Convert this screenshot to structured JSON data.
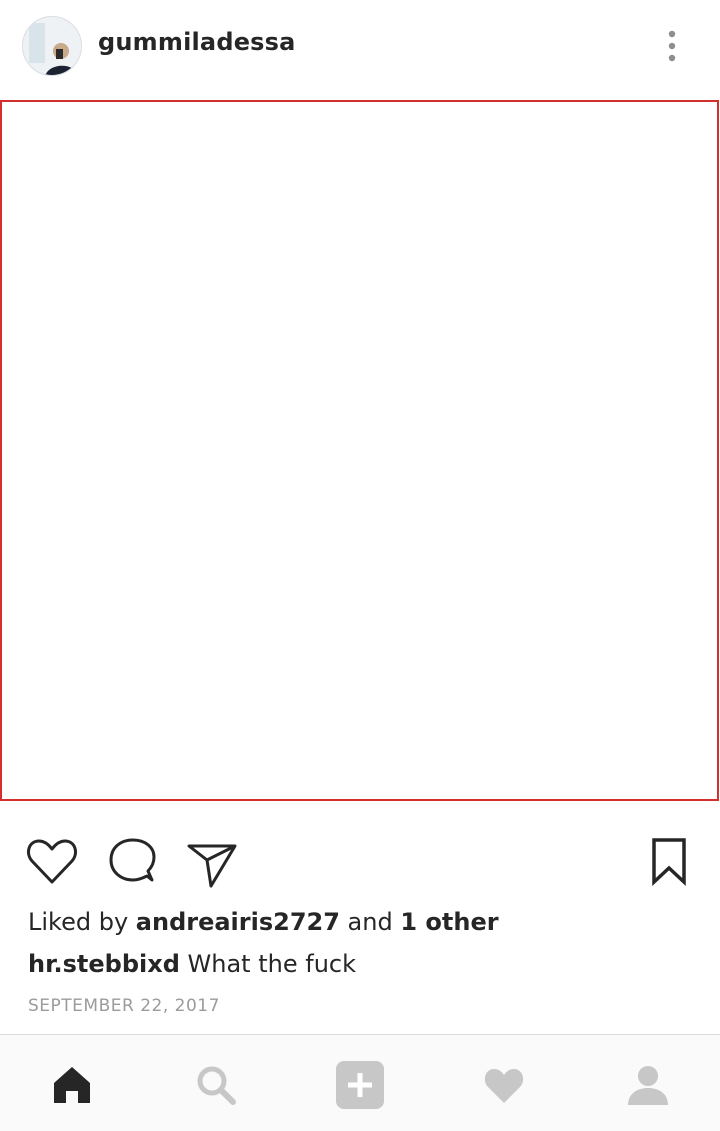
{
  "post": {
    "username": "gummiladessa",
    "likes": {
      "prefix": "Liked by ",
      "user": "andreairis2727",
      "middle": " and ",
      "others": "1 other"
    },
    "caption": {
      "user": "hr.stebbixd",
      "text": " What the fuck"
    },
    "date": "SEPTEMBER 22, 2017"
  },
  "icons": {
    "more": "more-vertical-icon",
    "like": "heart-outline-icon",
    "comment": "comment-bubble-icon",
    "share": "send-paper-plane-icon",
    "save": "bookmark-icon",
    "home": "home-icon",
    "search": "search-icon",
    "add": "add-post-icon",
    "activity": "heart-filled-icon",
    "profile": "profile-icon"
  },
  "colors": {
    "text": "#262626",
    "muted": "#9b9b9b",
    "frame": "#d32f2f",
    "nav_inactive": "#c7c7c7",
    "nav_active": "#262626"
  }
}
